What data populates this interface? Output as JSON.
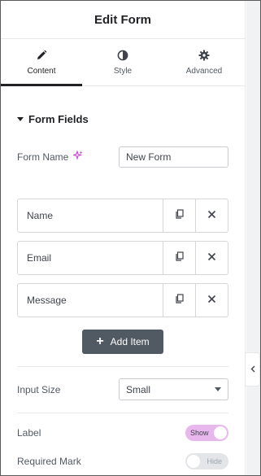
{
  "header": {
    "title": "Edit Form"
  },
  "tabs": [
    {
      "label": "Content",
      "icon": "pencil-icon",
      "active": true
    },
    {
      "label": "Style",
      "icon": "half-circle-icon",
      "active": false
    },
    {
      "label": "Advanced",
      "icon": "gear-icon",
      "active": false
    }
  ],
  "section": {
    "title": "Form Fields"
  },
  "form_name": {
    "label": "Form Name",
    "value": "New Form",
    "ai_icon": "sparkle-icon"
  },
  "fields": [
    {
      "label": "Name"
    },
    {
      "label": "Email"
    },
    {
      "label": "Message"
    }
  ],
  "add_item": {
    "label": "Add Item"
  },
  "input_size": {
    "label": "Input Size",
    "value": "Small"
  },
  "label_toggle": {
    "label": "Label",
    "state": "Show",
    "on": true
  },
  "required_toggle": {
    "label": "Required Mark",
    "state": "Hide",
    "on": false
  },
  "colors": {
    "accent": "#e8b7ee",
    "button": "#515962",
    "text": "#3f444b"
  }
}
